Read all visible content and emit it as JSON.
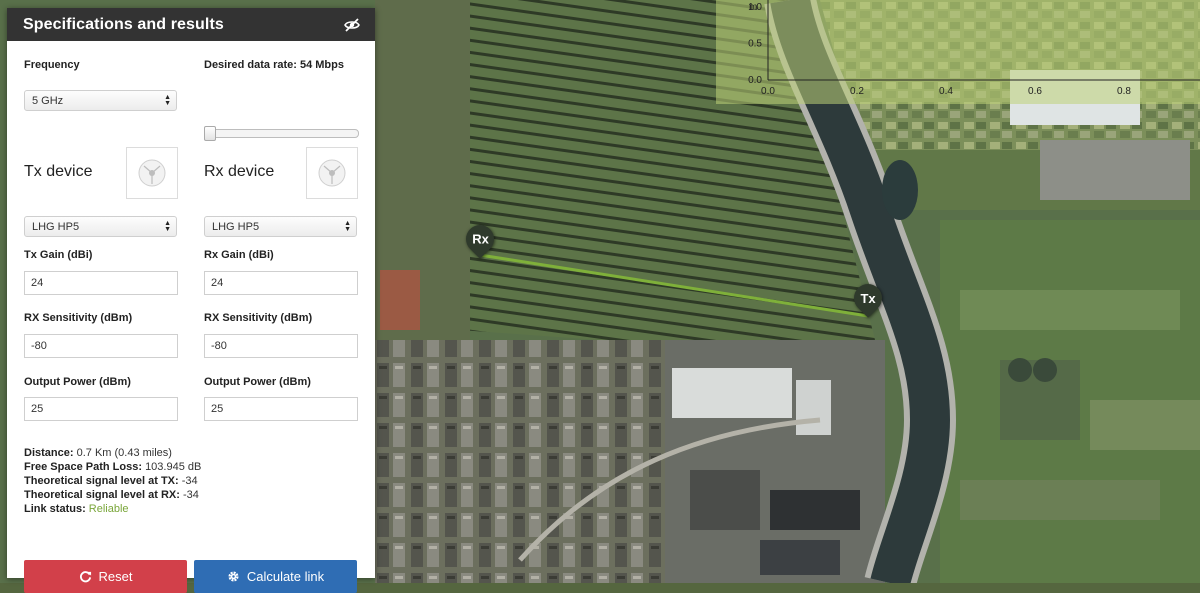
{
  "panel": {
    "title": "Specifications and results",
    "toggle_icon": "eye-slash-icon"
  },
  "frequency": {
    "label": "Frequency",
    "selected": "5 GHz"
  },
  "data_rate": {
    "label": "Desired data rate: 54 Mbps",
    "level_fraction": 0.0
  },
  "tx": {
    "title": "Tx device",
    "device": "LHG HP5",
    "gain_label": "Tx Gain (dBi)",
    "gain_value": "24",
    "sensitivity_label": "RX Sensitivity (dBm)",
    "sensitivity_value": "-80",
    "power_label": "Output Power (dBm)",
    "power_value": "25"
  },
  "rx": {
    "title": "Rx device",
    "device": "LHG HP5",
    "gain_label": "Rx Gain (dBi)",
    "gain_value": "24",
    "sensitivity_label": "RX Sensitivity (dBm)",
    "sensitivity_value": "-80",
    "power_label": "Output Power (dBm)",
    "power_value": "25"
  },
  "results": {
    "distance_label": "Distance:",
    "distance_value": "0.7 Km (0.43 miles)",
    "fspl_label": "Free Space Path Loss:",
    "fspl_value": "103.945 dB",
    "signal_tx_label": "Theoretical signal level at TX:",
    "signal_tx_value": "-34",
    "signal_rx_label": "Theoretical signal level at RX:",
    "signal_rx_value": "-34",
    "link_status_label": "Link status:",
    "link_status_value": "Reliable",
    "link_status_color": "#7aa63a"
  },
  "buttons": {
    "reset_label": "Reset",
    "reset_icon": "refresh-icon",
    "reset_color": "#d2404a",
    "calculate_label": "Calculate link",
    "calculate_icon": "gear-icon",
    "calculate_color": "#2f6db4"
  },
  "map": {
    "tx_marker": "Tx",
    "rx_marker": "Rx",
    "link_color": "#7fb03a"
  },
  "elevation_chart": {
    "y_unit": "m",
    "y_ticks": [
      "0.0",
      "0.5",
      "1.0"
    ],
    "x_ticks": [
      "0.0",
      "0.2",
      "0.4",
      "0.6",
      "0.8"
    ]
  }
}
